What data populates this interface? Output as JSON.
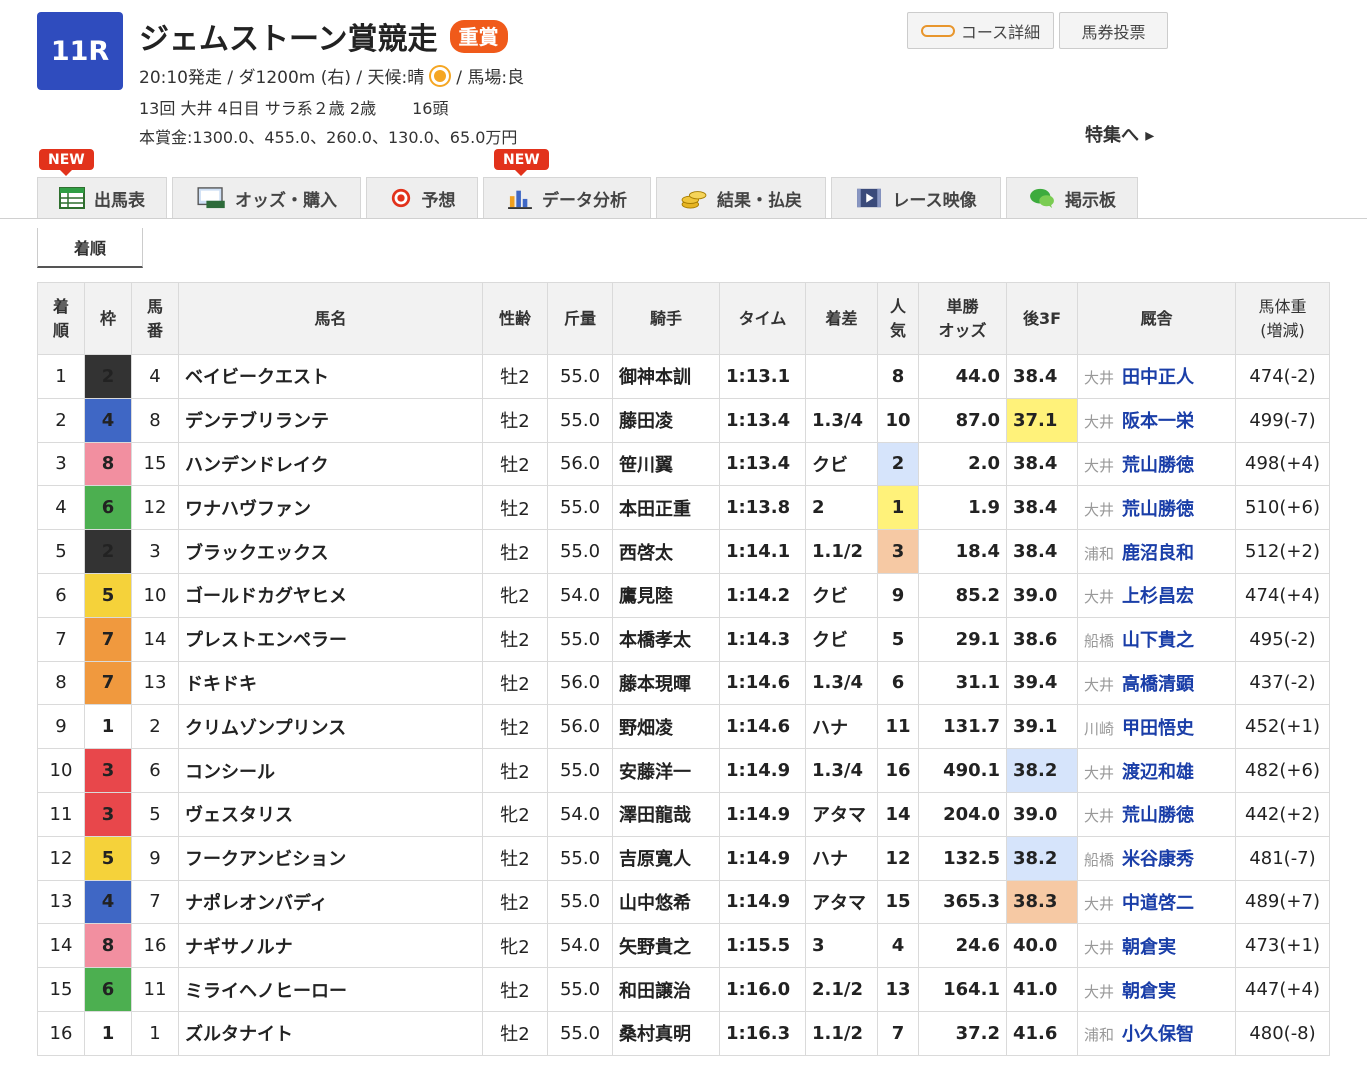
{
  "race": {
    "number": "11R",
    "title": "ジェムストーン賞競走",
    "grade": "重賞",
    "info1_pre": "20:10発走 / ダ1200m (右) / 天候:晴",
    "info1_post": "/ 馬場:良",
    "info2": "13回 大井 4日目 サラ系２歳 2歳",
    "heads": "16頭",
    "prize": "本賞金:1300.0、455.0、260.0、130.0、65.0万円"
  },
  "buttons": {
    "course": "コース詳細",
    "bet": "馬券投票"
  },
  "feature_link": "特集へ ▸",
  "tabs": [
    {
      "label": "出馬表",
      "new": "NEW"
    },
    {
      "label": "オッズ・購入"
    },
    {
      "label": "予想"
    },
    {
      "label": "データ分析",
      "new": "NEW"
    },
    {
      "label": "結果・払戻"
    },
    {
      "label": "レース映像"
    },
    {
      "label": "掲示板"
    }
  ],
  "subtab": "着順",
  "table": {
    "headers": {
      "rank": "着\n順",
      "waku": "枠",
      "umaban": "馬\n番",
      "horse": "馬名",
      "sex_age": "性齢",
      "weight": "斤量",
      "jockey": "騎手",
      "time": "タイム",
      "margin": "着差",
      "pop": "人\n気",
      "odds": "単勝\nオッズ",
      "last3f": "後3F",
      "stable": "厩舎",
      "body": "馬体重\n(増減)"
    },
    "rows": [
      {
        "rank": "1",
        "waku": "2",
        "num": "4",
        "horse": "ベイビークエスト",
        "sex": "牡2",
        "kg": "55.0",
        "jockey": "御神本訓",
        "time": "1:13.1",
        "margin": "",
        "pop": "8",
        "odds": "44.0",
        "f3": "38.4",
        "loc": "大井",
        "trainer": "田中正人",
        "body": "474(-2)"
      },
      {
        "rank": "2",
        "waku": "4",
        "num": "8",
        "horse": "デンテブリランテ",
        "sex": "牡2",
        "kg": "55.0",
        "jockey": "藤田凌",
        "time": "1:13.4",
        "margin": "1.3/4",
        "pop": "10",
        "odds": "87.0",
        "f3": "37.1",
        "loc": "大井",
        "trainer": "阪本一栄",
        "body": "499(-7)"
      },
      {
        "rank": "3",
        "waku": "8",
        "num": "15",
        "horse": "ハンデンドレイク",
        "sex": "牡2",
        "kg": "56.0",
        "jockey": "笹川翼",
        "time": "1:13.4",
        "margin": "クビ",
        "pop": "2",
        "odds": "2.0",
        "f3": "38.4",
        "loc": "大井",
        "trainer": "荒山勝徳",
        "body": "498(+4)"
      },
      {
        "rank": "4",
        "waku": "6",
        "num": "12",
        "horse": "ワナハヴファン",
        "sex": "牡2",
        "kg": "55.0",
        "jockey": "本田正重",
        "time": "1:13.8",
        "margin": "2",
        "pop": "1",
        "odds": "1.9",
        "f3": "38.4",
        "loc": "大井",
        "trainer": "荒山勝徳",
        "body": "510(+6)"
      },
      {
        "rank": "5",
        "waku": "2",
        "num": "3",
        "horse": "ブラックエックス",
        "sex": "牡2",
        "kg": "55.0",
        "jockey": "西啓太",
        "time": "1:14.1",
        "margin": "1.1/2",
        "pop": "3",
        "odds": "18.4",
        "f3": "38.4",
        "loc": "浦和",
        "trainer": "鹿沼良和",
        "body": "512(+2)"
      },
      {
        "rank": "6",
        "waku": "5",
        "num": "10",
        "horse": "ゴールドカグヤヒメ",
        "sex": "牝2",
        "kg": "54.0",
        "jockey": "鷹見陸",
        "time": "1:14.2",
        "margin": "クビ",
        "pop": "9",
        "odds": "85.2",
        "f3": "39.0",
        "loc": "大井",
        "trainer": "上杉昌宏",
        "body": "474(+4)"
      },
      {
        "rank": "7",
        "waku": "7",
        "num": "14",
        "horse": "プレストエンペラー",
        "sex": "牡2",
        "kg": "55.0",
        "jockey": "本橋孝太",
        "time": "1:14.3",
        "margin": "クビ",
        "pop": "5",
        "odds": "29.1",
        "f3": "38.6",
        "loc": "船橋",
        "trainer": "山下貴之",
        "body": "495(-2)"
      },
      {
        "rank": "8",
        "waku": "7",
        "num": "13",
        "horse": "ドキドキ",
        "sex": "牡2",
        "kg": "56.0",
        "jockey": "藤本現暉",
        "time": "1:14.6",
        "margin": "1.3/4",
        "pop": "6",
        "odds": "31.1",
        "f3": "39.4",
        "loc": "大井",
        "trainer": "高橋清顕",
        "body": "437(-2)"
      },
      {
        "rank": "9",
        "waku": "1",
        "num": "2",
        "horse": "クリムゾンプリンス",
        "sex": "牡2",
        "kg": "56.0",
        "jockey": "野畑凌",
        "time": "1:14.6",
        "margin": "ハナ",
        "pop": "11",
        "odds": "131.7",
        "f3": "39.1",
        "loc": "川崎",
        "trainer": "甲田悟史",
        "body": "452(+1)"
      },
      {
        "rank": "10",
        "waku": "3",
        "num": "6",
        "horse": "コンシール",
        "sex": "牡2",
        "kg": "55.0",
        "jockey": "安藤洋一",
        "time": "1:14.9",
        "margin": "1.3/4",
        "pop": "16",
        "odds": "490.1",
        "f3": "38.2",
        "loc": "大井",
        "trainer": "渡辺和雄",
        "body": "482(+6)"
      },
      {
        "rank": "11",
        "waku": "3",
        "num": "5",
        "horse": "ヴェスタリス",
        "sex": "牝2",
        "kg": "54.0",
        "jockey": "澤田龍哉",
        "time": "1:14.9",
        "margin": "アタマ",
        "pop": "14",
        "odds": "204.0",
        "f3": "39.0",
        "loc": "大井",
        "trainer": "荒山勝徳",
        "body": "442(+2)"
      },
      {
        "rank": "12",
        "waku": "5",
        "num": "9",
        "horse": "フークアンビション",
        "sex": "牡2",
        "kg": "55.0",
        "jockey": "吉原寛人",
        "time": "1:14.9",
        "margin": "ハナ",
        "pop": "12",
        "odds": "132.5",
        "f3": "38.2",
        "loc": "船橋",
        "trainer": "米谷康秀",
        "body": "481(-7)"
      },
      {
        "rank": "13",
        "waku": "4",
        "num": "7",
        "horse": "ナポレオンバディ",
        "sex": "牡2",
        "kg": "55.0",
        "jockey": "山中悠希",
        "time": "1:14.9",
        "margin": "アタマ",
        "pop": "15",
        "odds": "365.3",
        "f3": "38.3",
        "loc": "大井",
        "trainer": "中道啓二",
        "body": "489(+7)"
      },
      {
        "rank": "14",
        "waku": "8",
        "num": "16",
        "horse": "ナギサノルナ",
        "sex": "牝2",
        "kg": "54.0",
        "jockey": "矢野貴之",
        "time": "1:15.5",
        "margin": "3",
        "pop": "4",
        "odds": "24.6",
        "f3": "40.0",
        "loc": "大井",
        "trainer": "朝倉実",
        "body": "473(+1)"
      },
      {
        "rank": "15",
        "waku": "6",
        "num": "11",
        "horse": "ミライヘノヒーロー",
        "sex": "牡2",
        "kg": "55.0",
        "jockey": "和田譲治",
        "time": "1:16.0",
        "margin": "2.1/2",
        "pop": "13",
        "odds": "164.1",
        "f3": "41.0",
        "loc": "大井",
        "trainer": "朝倉実",
        "body": "447(+4)"
      },
      {
        "rank": "16",
        "waku": "1",
        "num": "1",
        "horse": "ズルタナイト",
        "sex": "牡2",
        "kg": "55.0",
        "jockey": "桑村真明",
        "time": "1:16.3",
        "margin": "1.1/2",
        "pop": "7",
        "odds": "37.2",
        "f3": "41.6",
        "loc": "浦和",
        "trainer": "小久保智",
        "body": "480(-8)"
      }
    ]
  },
  "highlights": {
    "pop": {
      "1": "yellow",
      "2": "blue",
      "3": "orange"
    },
    "f3_yellow": [
      "37.1"
    ],
    "f3_blue": [
      "38.2"
    ],
    "f3_orange": [
      "38.3"
    ],
    "red_odds_ranks": [
      "3",
      "4"
    ]
  },
  "colors": {
    "race_badge": "#2f4cbe",
    "grade_badge": "#f05a1a",
    "new_badge": "#e2321b",
    "link": "#1a3ea8",
    "waku": {
      "1": "#ffffff",
      "2": "#333333",
      "3": "#e8474b",
      "4": "#3f67c5",
      "5": "#f5d23a",
      "6": "#4caf50",
      "7": "#f0993e",
      "8": "#f28fa0"
    }
  }
}
